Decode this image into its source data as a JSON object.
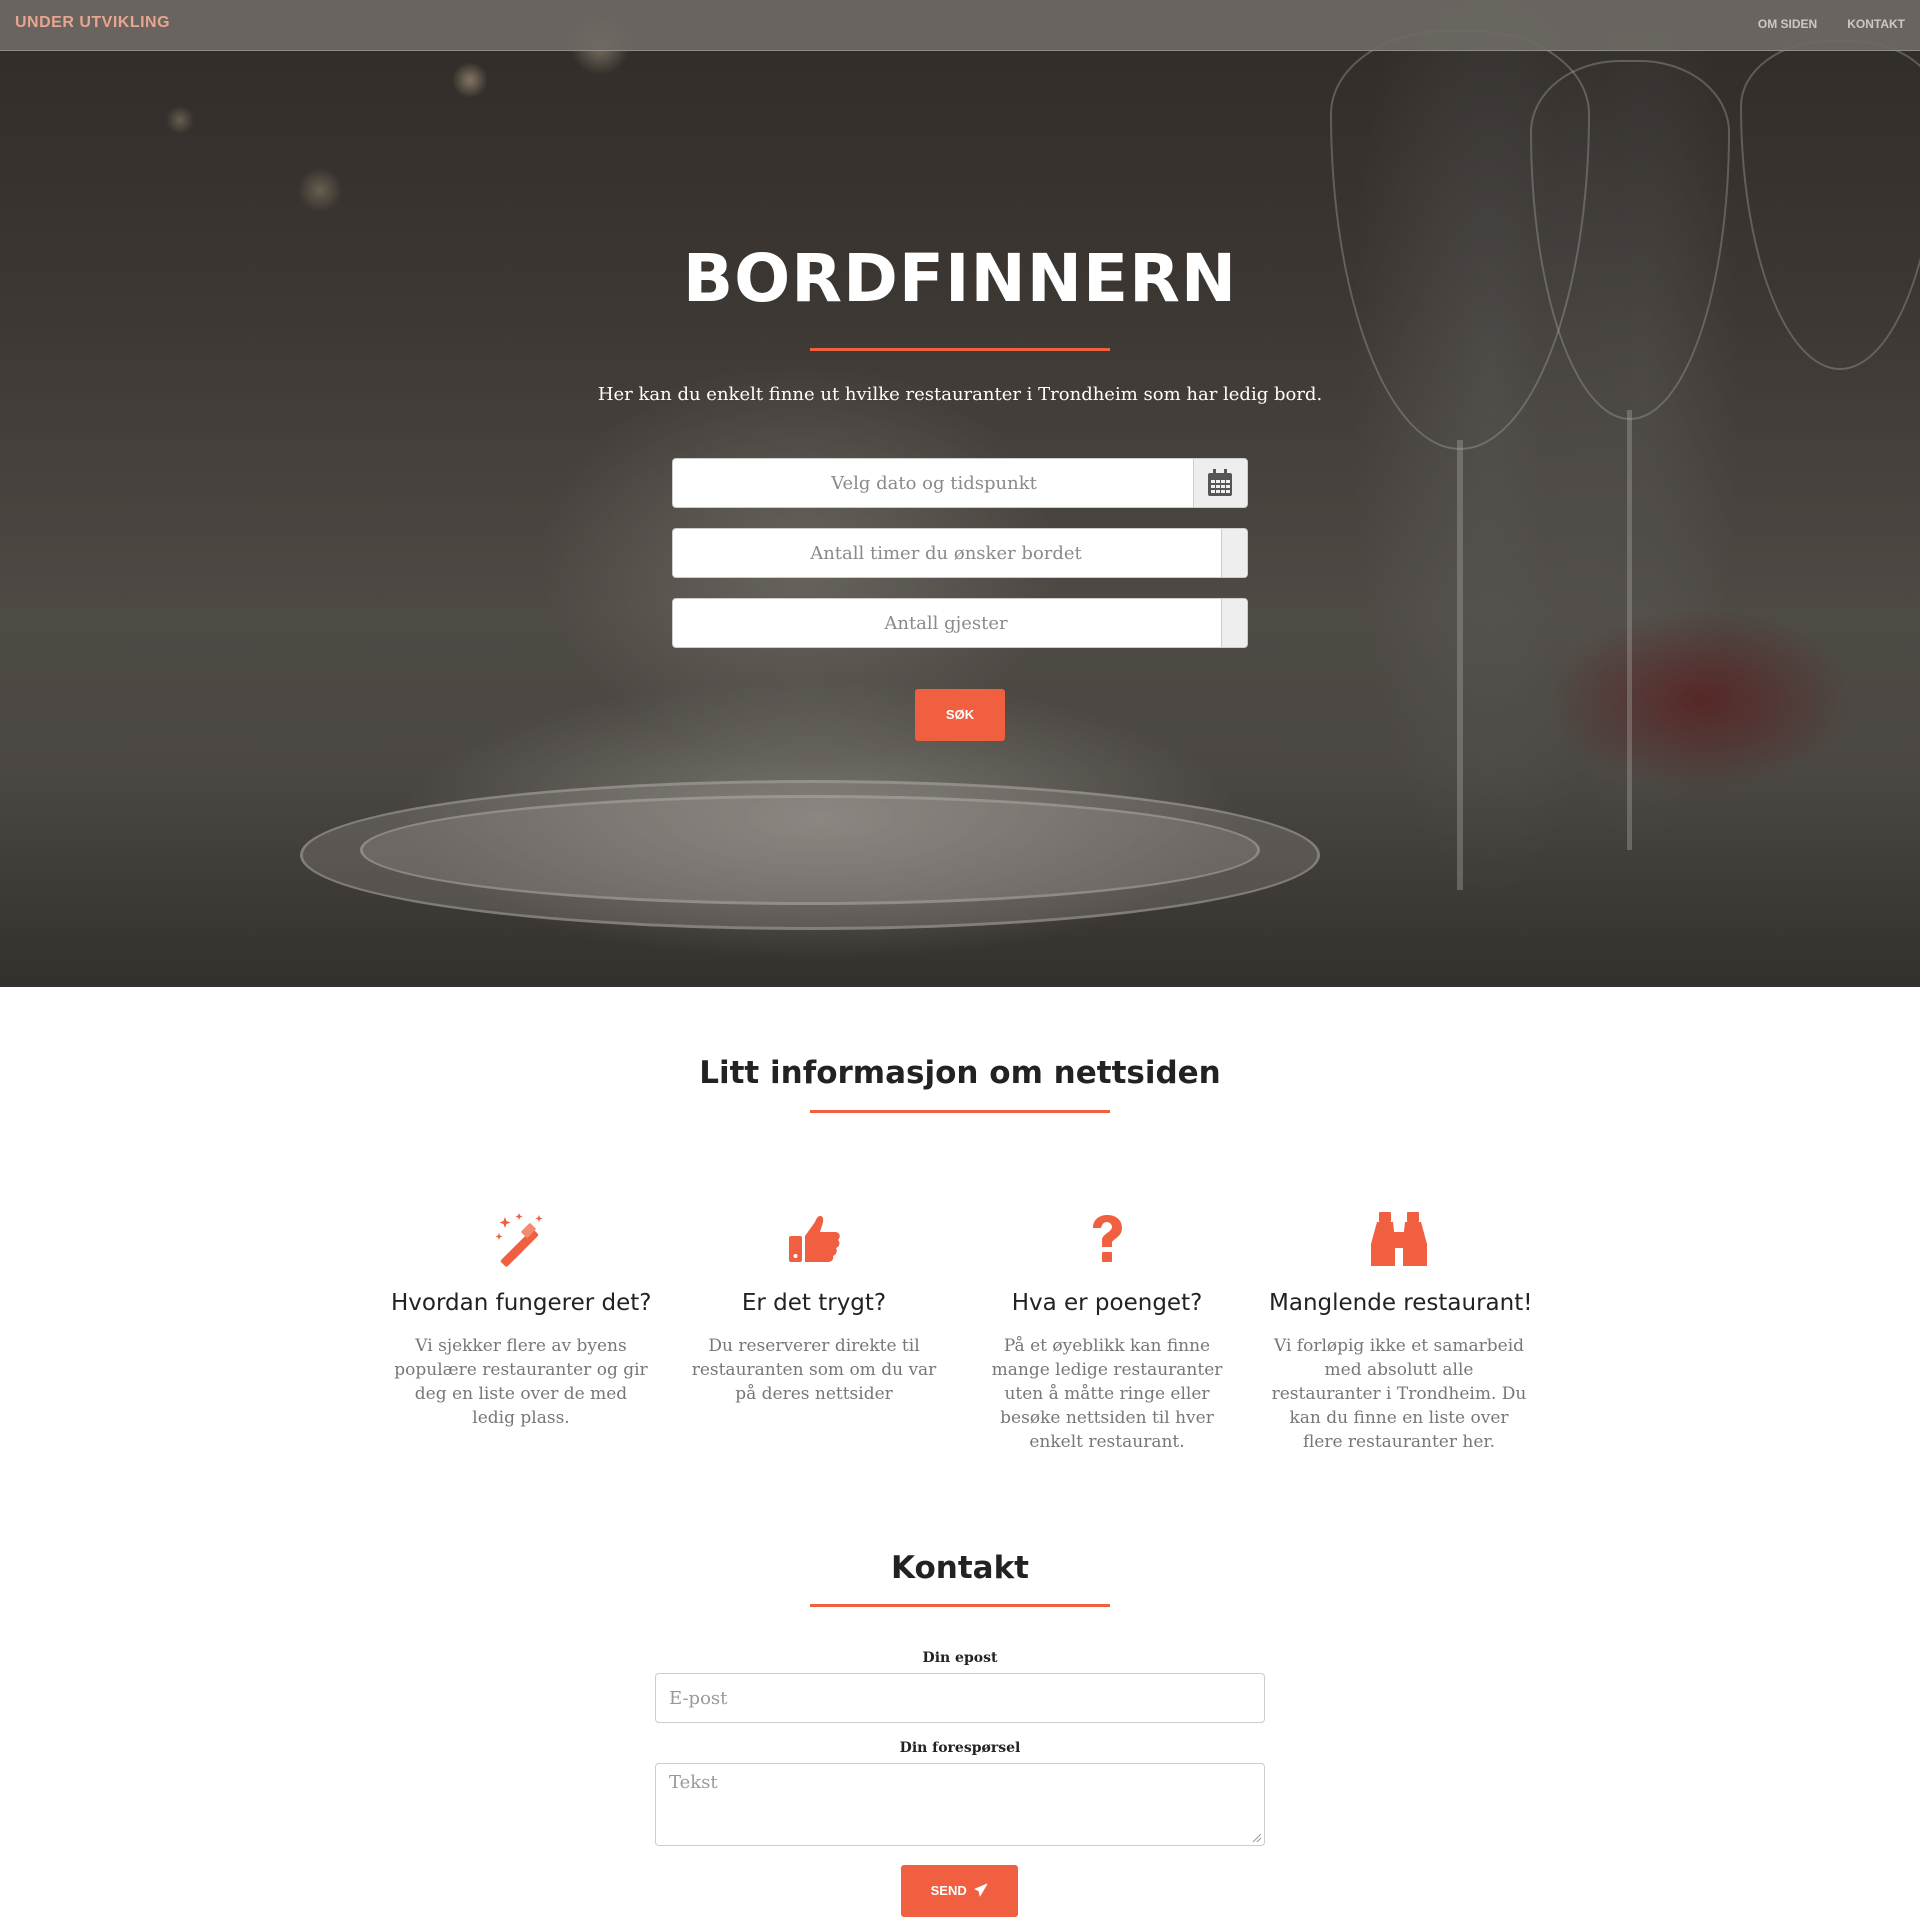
{
  "navbar": {
    "brand": "UNDER UTVIKLING",
    "links": [
      "OM SIDEN",
      "KONTAKT"
    ]
  },
  "hero": {
    "title": "BORDFINNERN",
    "subtitle": "Her kan du enkelt finne ut hvilke restauranter i Trondheim som har ledig bord.",
    "date_placeholder": "Velg dato og tidspunkt",
    "hours_placeholder": "Antall timer du ønsker bordet",
    "guests_placeholder": "Antall gjester",
    "search_label": "SØK"
  },
  "info": {
    "title": "Litt informasjon om nettsiden",
    "features": [
      {
        "icon": "magic-wand-icon",
        "title": "Hvordan fungerer det?",
        "text": "Vi sjekker flere av byens populære restauranter og gir deg en liste over de med ledig plass."
      },
      {
        "icon": "thumbs-up-icon",
        "title": "Er det trygt?",
        "text": "Du reserverer direkte til restauranten som om du var på deres nettsider"
      },
      {
        "icon": "question-mark-icon",
        "title": "Hva er poenget?",
        "text": "På et øyeblikk kan finne mange ledige restauranter uten å måtte ringe eller besøke nettsiden til hver enkelt restaurant."
      },
      {
        "icon": "binoculars-icon",
        "title": "Manglende restaurant!",
        "text": "Vi forløpig ikke et samarbeid med absolutt alle restauranter i Trondheim. Du kan du finne en liste over flere restauranter her."
      }
    ]
  },
  "contact": {
    "title": "Kontakt",
    "email_label": "Din epost",
    "email_placeholder": "E-post",
    "request_label": "Din forespørsel",
    "request_placeholder": "Tekst",
    "send_label": "SEND"
  },
  "colors": {
    "accent": "#f05f40",
    "brand": "#e8a58f"
  }
}
